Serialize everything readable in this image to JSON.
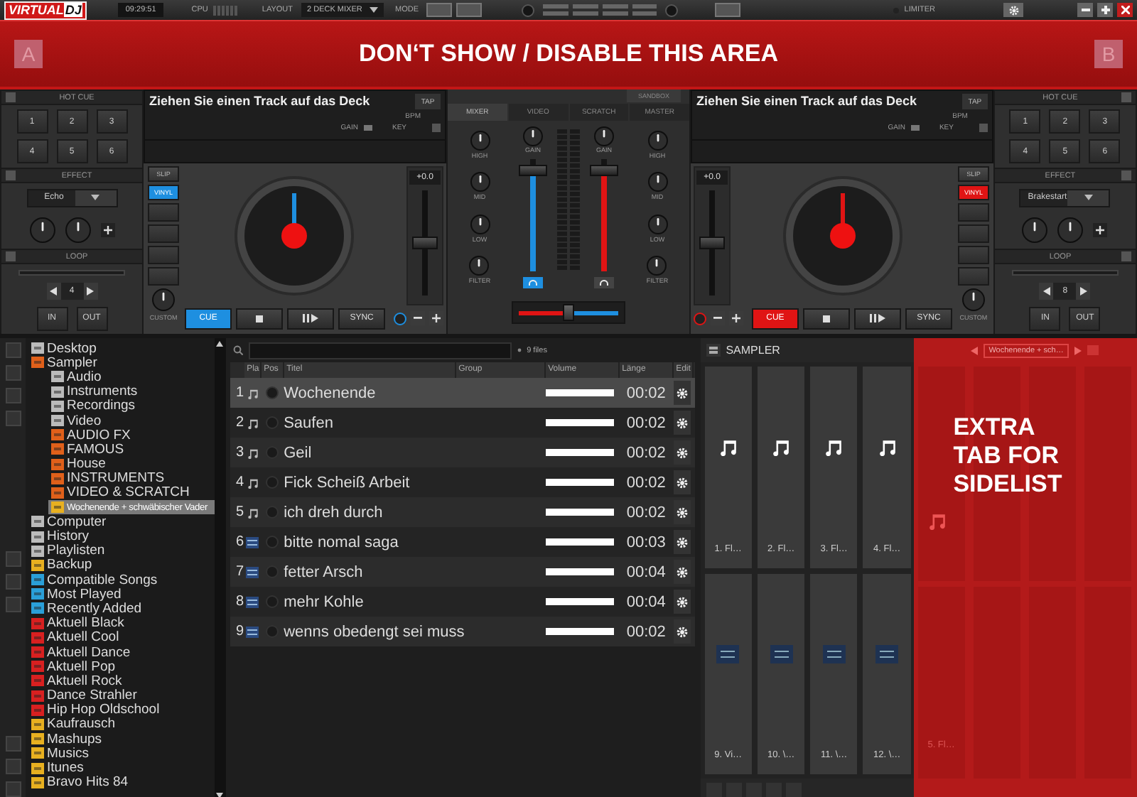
{
  "top_bar": {
    "logo": {
      "text": "VIRTUAL",
      "accent": "DJ"
    },
    "time": "09:29:51",
    "cpu_label": "CPU",
    "layout_label": "LAYOUT",
    "layout": "2 DECK MIXER",
    "mode_label": "MODE",
    "limiter_label": "LIMITER"
  },
  "notice": {
    "left_deck": "A",
    "text": "DON‘T SHOW / DISABLE THIS AREA",
    "right_deck": "B"
  },
  "effect_panels": [
    {
      "hot_cue_title": "HOT CUE",
      "hot_cues": [
        "1",
        "2",
        "3",
        "4",
        "5",
        "6"
      ],
      "effect_title": "EFFECT",
      "effect": "Echo",
      "loop_title": "LOOP",
      "loop_size": "4",
      "loop_in": "IN",
      "loop_out": "OUT"
    },
    {
      "hot_cue_title": "HOT CUE",
      "hot_cues": [
        "1",
        "2",
        "3",
        "4",
        "5",
        "6"
      ],
      "effect_title": "EFFECT",
      "effect": "Brakestart",
      "loop_title": "LOOP",
      "loop_size": "8",
      "loop_in": "IN",
      "loop_out": "OUT"
    }
  ],
  "decks": [
    {
      "mirrored": false,
      "color": "#1e8fe0",
      "message": "Ziehen Sie einen Track auf das Deck",
      "tap": "TAP",
      "bpm_label": "BPM",
      "gain_label": "GAIN",
      "key_label": "KEY",
      "slip": "SLIP",
      "vinyl": {
        "label": "VINYL",
        "on": true
      },
      "custom": "CUSTOM",
      "pitch": {
        "reading": "+0.0",
        "level": 0.5
      },
      "cue": "CUE",
      "sync": "SYNC"
    },
    {
      "mirrored": true,
      "color": "#e01414",
      "message": "Ziehen Sie einen Track auf das Deck",
      "tap": "TAP",
      "bpm_label": "BPM",
      "gain_label": "GAIN",
      "key_label": "KEY",
      "slip": "SLIP",
      "vinyl": {
        "label": "VINYL",
        "on": true
      },
      "custom": "CUSTOM",
      "pitch": {
        "reading": "+0.0",
        "level": 0.5
      },
      "cue": "CUE",
      "sync": "SYNC"
    }
  ],
  "mixer": {
    "sandbox": "SANDBOX",
    "tabs": [
      {
        "label": "MIXER",
        "selected": true
      },
      {
        "label": "VIDEO",
        "selected": false
      },
      {
        "label": "SCRATCH",
        "selected": false
      },
      {
        "label": "MASTER",
        "selected": false
      }
    ],
    "eq_columns": [
      {
        "labels": [
          "HIGH",
          "MID",
          "LOW",
          "FILTER"
        ]
      },
      {
        "labels": [
          "HIGH",
          "MID",
          "LOW",
          "FILTER"
        ]
      }
    ],
    "channels": [
      {
        "gain_label": "GAIN",
        "level": 0.9,
        "color": "#1e8fe0",
        "headphones_on": true
      },
      {
        "gain_label": "GAIN",
        "level": 0.9,
        "color": "#e01414",
        "headphones_on": false
      }
    ],
    "crossfader": {
      "level": 0.5
    }
  },
  "browser": {
    "folders": [
      {
        "label": "Desktop",
        "kind": "system",
        "selected": false
      },
      {
        "label": "Sampler",
        "kind": "sampler",
        "selected": false,
        "children": [
          {
            "label": "Audio",
            "kind": "system",
            "selected": false
          },
          {
            "label": "Instruments",
            "kind": "system",
            "selected": false
          },
          {
            "label": "Recordings",
            "kind": "system",
            "selected": false
          },
          {
            "label": "Video",
            "kind": "system",
            "selected": false
          },
          {
            "label": "AUDIO FX",
            "kind": "sampler",
            "selected": false
          },
          {
            "label": "FAMOUS",
            "kind": "sampler",
            "selected": false
          },
          {
            "label": "House",
            "kind": "sampler",
            "selected": false
          },
          {
            "label": "INSTRUMENTS",
            "kind": "sampler",
            "selected": false
          },
          {
            "label": "VIDEO & SCRATCH",
            "kind": "sampler",
            "selected": false
          },
          {
            "label": "Wochenende + schwäbischer Vader",
            "kind": "folder",
            "selected": true
          }
        ]
      },
      {
        "label": "Computer",
        "kind": "system",
        "selected": false
      },
      {
        "label": "History",
        "kind": "system",
        "selected": false
      },
      {
        "label": "Playlisten",
        "kind": "system",
        "selected": false
      },
      {
        "label": "Backup",
        "kind": "folder",
        "selected": false
      },
      {
        "label": "Compatible Songs",
        "kind": "filter",
        "selected": false
      },
      {
        "label": "Most Played",
        "kind": "filter",
        "selected": false
      },
      {
        "label": "Recently Added",
        "kind": "filter",
        "selected": false
      },
      {
        "label": "Aktuell Black",
        "kind": "list",
        "selected": false
      },
      {
        "label": "Aktuell Cool",
        "kind": "list",
        "selected": false
      },
      {
        "label": "Aktuell Dance",
        "kind": "list",
        "selected": false
      },
      {
        "label": "Aktuell Pop",
        "kind": "list",
        "selected": false
      },
      {
        "label": "Aktuell Rock",
        "kind": "list",
        "selected": false
      },
      {
        "label": "Dance Strahler",
        "kind": "list",
        "selected": false
      },
      {
        "label": "Hip Hop Oldschool",
        "kind": "list",
        "selected": false
      },
      {
        "label": "Kaufrausch",
        "kind": "folder",
        "selected": false
      },
      {
        "label": "Mashups",
        "kind": "folder",
        "selected": false
      },
      {
        "label": "Musics",
        "kind": "folder",
        "selected": false
      },
      {
        "label": "Itunes",
        "kind": "folder",
        "selected": false
      },
      {
        "label": "Bravo Hits 84",
        "kind": "folder",
        "selected": false
      }
    ]
  },
  "file_list": {
    "file_count": "9 files",
    "columns": [
      "Pla",
      "Pos",
      "Titel",
      "Group",
      "Volume",
      "Länge",
      "Edit"
    ],
    "rows": [
      {
        "number": "1",
        "kind": "audio",
        "title": "Wochenende",
        "length": "00:02",
        "selected": true
      },
      {
        "number": "2",
        "kind": "audio",
        "title": "Saufen",
        "length": "00:02",
        "selected": false
      },
      {
        "number": "3",
        "kind": "audio",
        "title": "Geil",
        "length": "00:02",
        "selected": false
      },
      {
        "number": "4",
        "kind": "audio",
        "title": "Fick Scheiß Arbeit",
        "length": "00:02",
        "selected": false
      },
      {
        "number": "5",
        "kind": "audio",
        "title": "ich dreh durch",
        "length": "00:02",
        "selected": false
      },
      {
        "number": "6",
        "kind": "video",
        "title": "bitte nomal saga",
        "length": "00:03",
        "selected": false
      },
      {
        "number": "7",
        "kind": "video",
        "title": "fetter Arsch",
        "length": "00:04",
        "selected": false
      },
      {
        "number": "8",
        "kind": "video",
        "title": "mehr Kohle",
        "length": "00:04",
        "selected": false
      },
      {
        "number": "9",
        "kind": "video",
        "title": "wenns obedengt sei muss",
        "length": "00:02",
        "selected": false
      }
    ]
  },
  "sampler": {
    "title": "SAMPLER",
    "pads": [
      {
        "label": "1. Fl…",
        "kind": "audio"
      },
      {
        "label": "2. Fl…",
        "kind": "audio"
      },
      {
        "label": "3. Fl…",
        "kind": "audio"
      },
      {
        "label": "4. Fl…",
        "kind": "audio"
      },
      {
        "label": "9. Vi…",
        "kind": "video"
      },
      {
        "label": "10. \\…",
        "kind": "video"
      },
      {
        "label": "11. \\…",
        "kind": "video"
      },
      {
        "label": "12. \\…",
        "kind": "video"
      }
    ],
    "sidelist": {
      "path": "Wochenende + sch…",
      "pad_label": "5. Fl…",
      "message": "EXTRA TAB FOR SIDELIST"
    }
  }
}
